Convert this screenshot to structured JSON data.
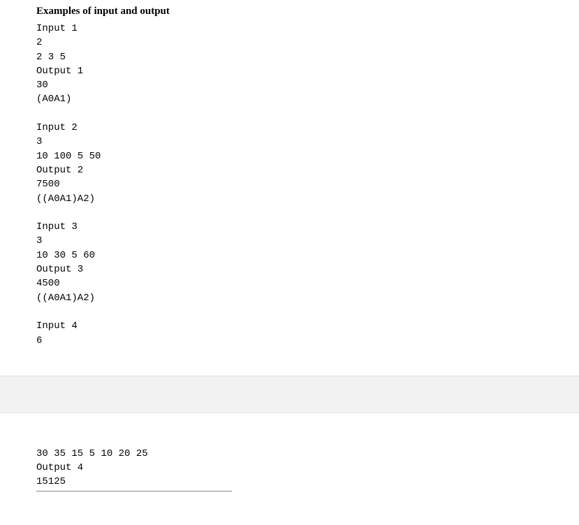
{
  "heading": "Examples of input and output",
  "examples": [
    {
      "input_label": "Input 1",
      "input_lines": [
        "2",
        "2 3 5"
      ],
      "output_label": "Output 1",
      "output_lines": [
        "30",
        "(A0A1)"
      ]
    },
    {
      "input_label": "Input 2",
      "input_lines": [
        "3",
        "10 100 5 50"
      ],
      "output_label": "Output 2",
      "output_lines": [
        "7500",
        "((A0A1)A2)"
      ]
    },
    {
      "input_label": "Input 3",
      "input_lines": [
        "3",
        "10 30 5 60"
      ],
      "output_label": "Output 3",
      "output_lines": [
        "4500",
        "((A0A1)A2)"
      ]
    },
    {
      "input_label": "Input 4",
      "input_lines": [
        "6"
      ],
      "output_label": "Output 4",
      "output_lines_pre": [
        "30 35 15 5 10 20 25"
      ],
      "output_lines": [
        "15125"
      ]
    }
  ]
}
